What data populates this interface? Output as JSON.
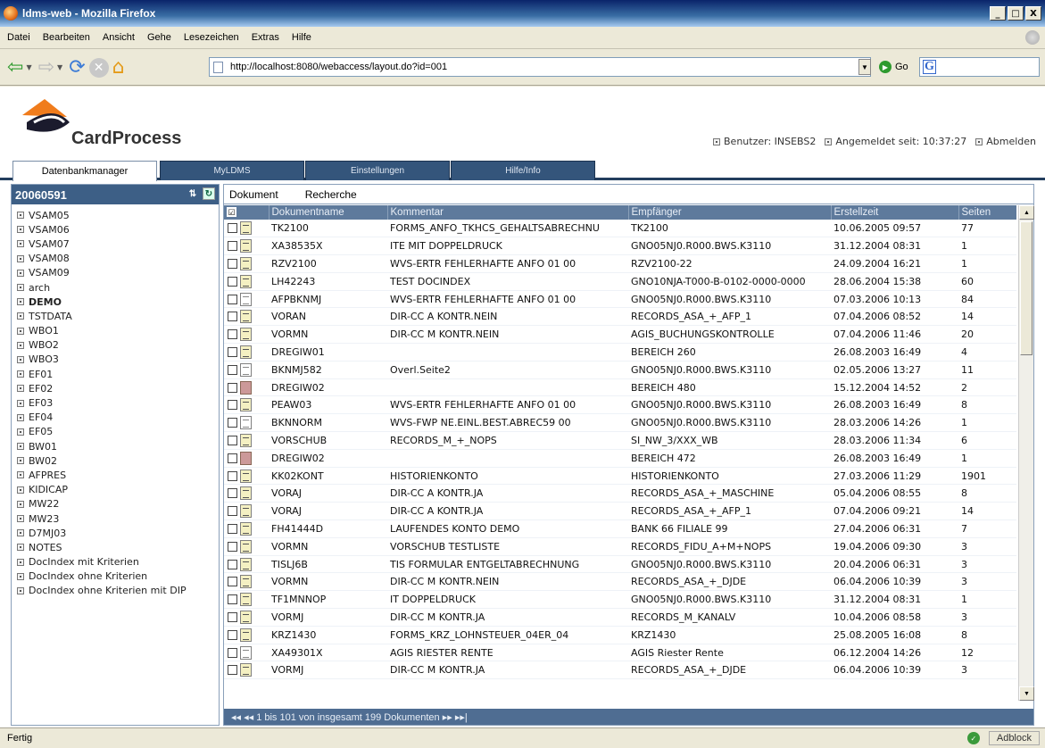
{
  "window": {
    "title": "ldms-web - Mozilla Firefox",
    "min": "_",
    "max": "□",
    "close": "X"
  },
  "menu": [
    "Datei",
    "Bearbeiten",
    "Ansicht",
    "Gehe",
    "Lesezeichen",
    "Extras",
    "Hilfe"
  ],
  "nav": {
    "url": "http://localhost:8080/webaccess/layout.do?id=001",
    "go_label": "Go",
    "search_placeholder": ""
  },
  "header": {
    "brand": "CardProcess",
    "user": "Benutzer: INSEBS2",
    "login": "Angemeldet seit: 10:37:27",
    "logout": "Abmelden"
  },
  "tabs": [
    "Datenbankmanager",
    "MyLDMS",
    "Einstellungen",
    "Hilfe/Info"
  ],
  "sidebar": {
    "title": "20060591",
    "items": [
      {
        "label": "VSAM05",
        "bold": false
      },
      {
        "label": "VSAM06",
        "bold": false
      },
      {
        "label": "VSAM07",
        "bold": false
      },
      {
        "label": "VSAM08",
        "bold": false
      },
      {
        "label": "VSAM09",
        "bold": false
      },
      {
        "label": "arch",
        "bold": false
      },
      {
        "label": "DEMO",
        "bold": true
      },
      {
        "label": "TSTDATA",
        "bold": false
      },
      {
        "label": "WBO1",
        "bold": false
      },
      {
        "label": "WBO2",
        "bold": false
      },
      {
        "label": "WBO3",
        "bold": false
      },
      {
        "label": "EF01",
        "bold": false
      },
      {
        "label": "EF02",
        "bold": false
      },
      {
        "label": "EF03",
        "bold": false
      },
      {
        "label": "EF04",
        "bold": false
      },
      {
        "label": "EF05",
        "bold": false
      },
      {
        "label": "BW01",
        "bold": false
      },
      {
        "label": "BW02",
        "bold": false
      },
      {
        "label": "AFPRES",
        "bold": false
      },
      {
        "label": "KIDICAP",
        "bold": false
      },
      {
        "label": "MW22",
        "bold": false
      },
      {
        "label": "MW23",
        "bold": false
      },
      {
        "label": "D7MJ03",
        "bold": false
      },
      {
        "label": "NOTES",
        "bold": false
      },
      {
        "label": "DocIndex mit Kriterien",
        "bold": false
      },
      {
        "label": "DocIndex ohne Kriterien",
        "bold": false
      },
      {
        "label": "DocIndex ohne Kriterien mit DIP",
        "bold": false
      }
    ]
  },
  "main": {
    "tabs": [
      "Dokument",
      "Recherche"
    ],
    "columns": [
      "Dokumentname",
      "Kommentar",
      "Empfänger",
      "Erstellzeit",
      "Seiten"
    ],
    "rows": [
      {
        "icon": "doc",
        "name": "TK2100",
        "comment": "FORMS_ANFO_TKHCS_GEHALTSABRECHNU",
        "recipient": "TK2100",
        "created": "10.06.2005 09:57",
        "pages": "77"
      },
      {
        "icon": "doc",
        "name": "XA38535X",
        "comment": "ITE MIT DOPPELDRUCK",
        "recipient": "GNO05NJ0.R000.BWS.K3110",
        "created": "31.12.2004 08:31",
        "pages": "1"
      },
      {
        "icon": "doc",
        "name": "RZV2100",
        "comment": "WVS-ERTR FEHLERHAFTE ANFO 01 00",
        "recipient": "RZV2100-22",
        "created": "24.09.2004 16:21",
        "pages": "1"
      },
      {
        "icon": "doc",
        "name": "LH42243",
        "comment": "TEST DOCINDEX",
        "recipient": "GNO10NJA-T000-B-0102-0000-0000",
        "created": "28.06.2004 15:38",
        "pages": "60"
      },
      {
        "icon": "plain",
        "name": "AFPBKNMJ",
        "comment": "WVS-ERTR FEHLERHAFTE ANFO 01 00",
        "recipient": "GNO05NJ0.R000.BWS.K3110",
        "created": "07.03.2006 10:13",
        "pages": "84"
      },
      {
        "icon": "doc",
        "name": "VORAN",
        "comment": "DIR-CC A KONTR.NEIN",
        "recipient": "RECORDS_ASA_+_AFP_1",
        "created": "07.04.2006 08:52",
        "pages": "14"
      },
      {
        "icon": "doc",
        "name": "VORMN",
        "comment": "DIR-CC M KONTR.NEIN",
        "recipient": "AGIS_BUCHUNGSKONTROLLE",
        "created": "07.04.2006 11:46",
        "pages": "20"
      },
      {
        "icon": "doc",
        "name": "DREGIW01",
        "comment": "",
        "recipient": "BEREICH 260",
        "created": "26.08.2003 16:49",
        "pages": "4"
      },
      {
        "icon": "plain",
        "name": "BKNMJ582",
        "comment": "Overl.Seite2",
        "recipient": "GNO05NJ0.R000.BWS.K3110",
        "created": "02.05.2006 13:27",
        "pages": "11"
      },
      {
        "icon": "img",
        "name": "DREGIW02",
        "comment": "",
        "recipient": "BEREICH 480",
        "created": "15.12.2004 14:52",
        "pages": "2"
      },
      {
        "icon": "doc",
        "name": "PEAW03",
        "comment": "WVS-ERTR FEHLERHAFTE ANFO 01 00",
        "recipient": "GNO05NJ0.R000.BWS.K3110",
        "created": "26.08.2003 16:49",
        "pages": "8"
      },
      {
        "icon": "plain",
        "name": "BKNNORM",
        "comment": "WVS-FWP NE.EINL.BEST.ABREC59 00",
        "recipient": "GNO05NJ0.R000.BWS.K3110",
        "created": "28.03.2006 14:26",
        "pages": "1"
      },
      {
        "icon": "doc",
        "name": "VORSCHUB",
        "comment": "RECORDS_M_+_NOPS",
        "recipient": "SI_NW_3/XXX_WB",
        "created": "28.03.2006 11:34",
        "pages": "6"
      },
      {
        "icon": "img",
        "name": "DREGIW02",
        "comment": "",
        "recipient": "BEREICH 472",
        "created": "26.08.2003 16:49",
        "pages": "1"
      },
      {
        "icon": "doc",
        "name": "KK02KONT",
        "comment": "HISTORIENKONTO",
        "recipient": "HISTORIENKONTO",
        "created": "27.03.2006 11:29",
        "pages": "1901"
      },
      {
        "icon": "doc",
        "name": "VORAJ",
        "comment": "DIR-CC A KONTR.JA",
        "recipient": "RECORDS_ASA_+_MASCHINE",
        "created": "05.04.2006 08:55",
        "pages": "8"
      },
      {
        "icon": "doc",
        "name": "VORAJ",
        "comment": "DIR-CC A KONTR.JA",
        "recipient": "RECORDS_ASA_+_AFP_1",
        "created": "07.04.2006 09:21",
        "pages": "14"
      },
      {
        "icon": "doc",
        "name": "FH41444D",
        "comment": "LAUFENDES KONTO DEMO",
        "recipient": "BANK 66 FILIALE 99",
        "created": "27.04.2006 06:31",
        "pages": "7"
      },
      {
        "icon": "doc",
        "name": "VORMN",
        "comment": "VORSCHUB TESTLISTE",
        "recipient": "RECORDS_FIDU_A+M+NOPS",
        "created": "19.04.2006 09:30",
        "pages": "3"
      },
      {
        "icon": "doc",
        "name": "TISLJ6B",
        "comment": "TIS FORMULAR ENTGELTABRECHNUNG",
        "recipient": "GNO05NJ0.R000.BWS.K3110",
        "created": "20.04.2006 06:31",
        "pages": "3"
      },
      {
        "icon": "doc",
        "name": "VORMN",
        "comment": "DIR-CC M KONTR.NEIN",
        "recipient": "RECORDS_ASA_+_DJDE",
        "created": "06.04.2006 10:39",
        "pages": "3"
      },
      {
        "icon": "doc",
        "name": "TF1MNNOP",
        "comment": "IT DOPPELDRUCK",
        "recipient": "GNO05NJ0.R000.BWS.K3110",
        "created": "31.12.2004 08:31",
        "pages": "1"
      },
      {
        "icon": "doc",
        "name": "VORMJ",
        "comment": "DIR-CC M KONTR.JA",
        "recipient": "RECORDS_M_KANALV",
        "created": "10.04.2006 08:58",
        "pages": "3"
      },
      {
        "icon": "doc",
        "name": "KRZ1430",
        "comment": "FORMS_KRZ_LOHNSTEUER_04ER_04",
        "recipient": "KRZ1430",
        "created": "25.08.2005 16:08",
        "pages": "8"
      },
      {
        "icon": "plain",
        "name": "XA49301X",
        "comment": "AGIS RIESTER RENTE",
        "recipient": "AGIS Riester Rente",
        "created": "06.12.2004 14:26",
        "pages": "12"
      },
      {
        "icon": "doc",
        "name": "VORMJ",
        "comment": "DIR-CC M KONTR.JA",
        "recipient": "RECORDS_ASA_+_DJDE",
        "created": "06.04.2006 10:39",
        "pages": "3"
      }
    ],
    "pager": "◂◂ ◂◂ 1 bis 101 von insgesamt 199 Dokumenten ▸▸ ▸▸|"
  },
  "status": {
    "text": "Fertig",
    "adblock": "Adblock"
  }
}
